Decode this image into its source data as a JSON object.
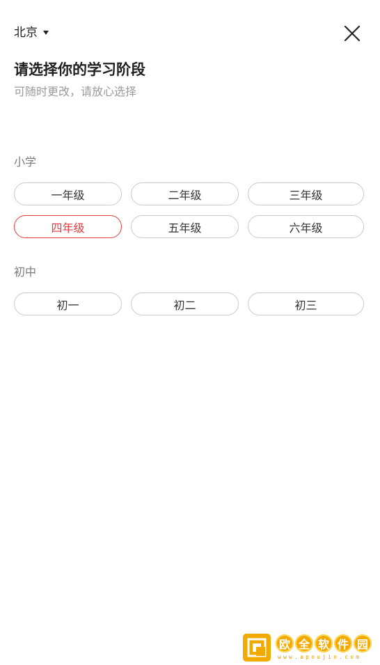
{
  "header": {
    "city": "北京",
    "close_icon": "close-icon",
    "dropdown_icon": "caret-down-icon"
  },
  "main": {
    "title": "请选择你的学习阶段",
    "subtitle": "可随时更改，请放心选择"
  },
  "sections": [
    {
      "label": "小学",
      "grades": [
        "一年级",
        "二年级",
        "三年级",
        "四年级",
        "五年级",
        "六年级"
      ]
    },
    {
      "label": "初中",
      "grades": [
        "初一",
        "初二",
        "初三"
      ]
    }
  ],
  "selected_grade": "四年级",
  "colors": {
    "accent": "#e8383d",
    "border": "#c9c9c9",
    "watermark": "#f2a900"
  },
  "watermark": {
    "chars": [
      "欧",
      "全",
      "软",
      "件",
      "园"
    ],
    "url": "www.apoujin.com"
  }
}
